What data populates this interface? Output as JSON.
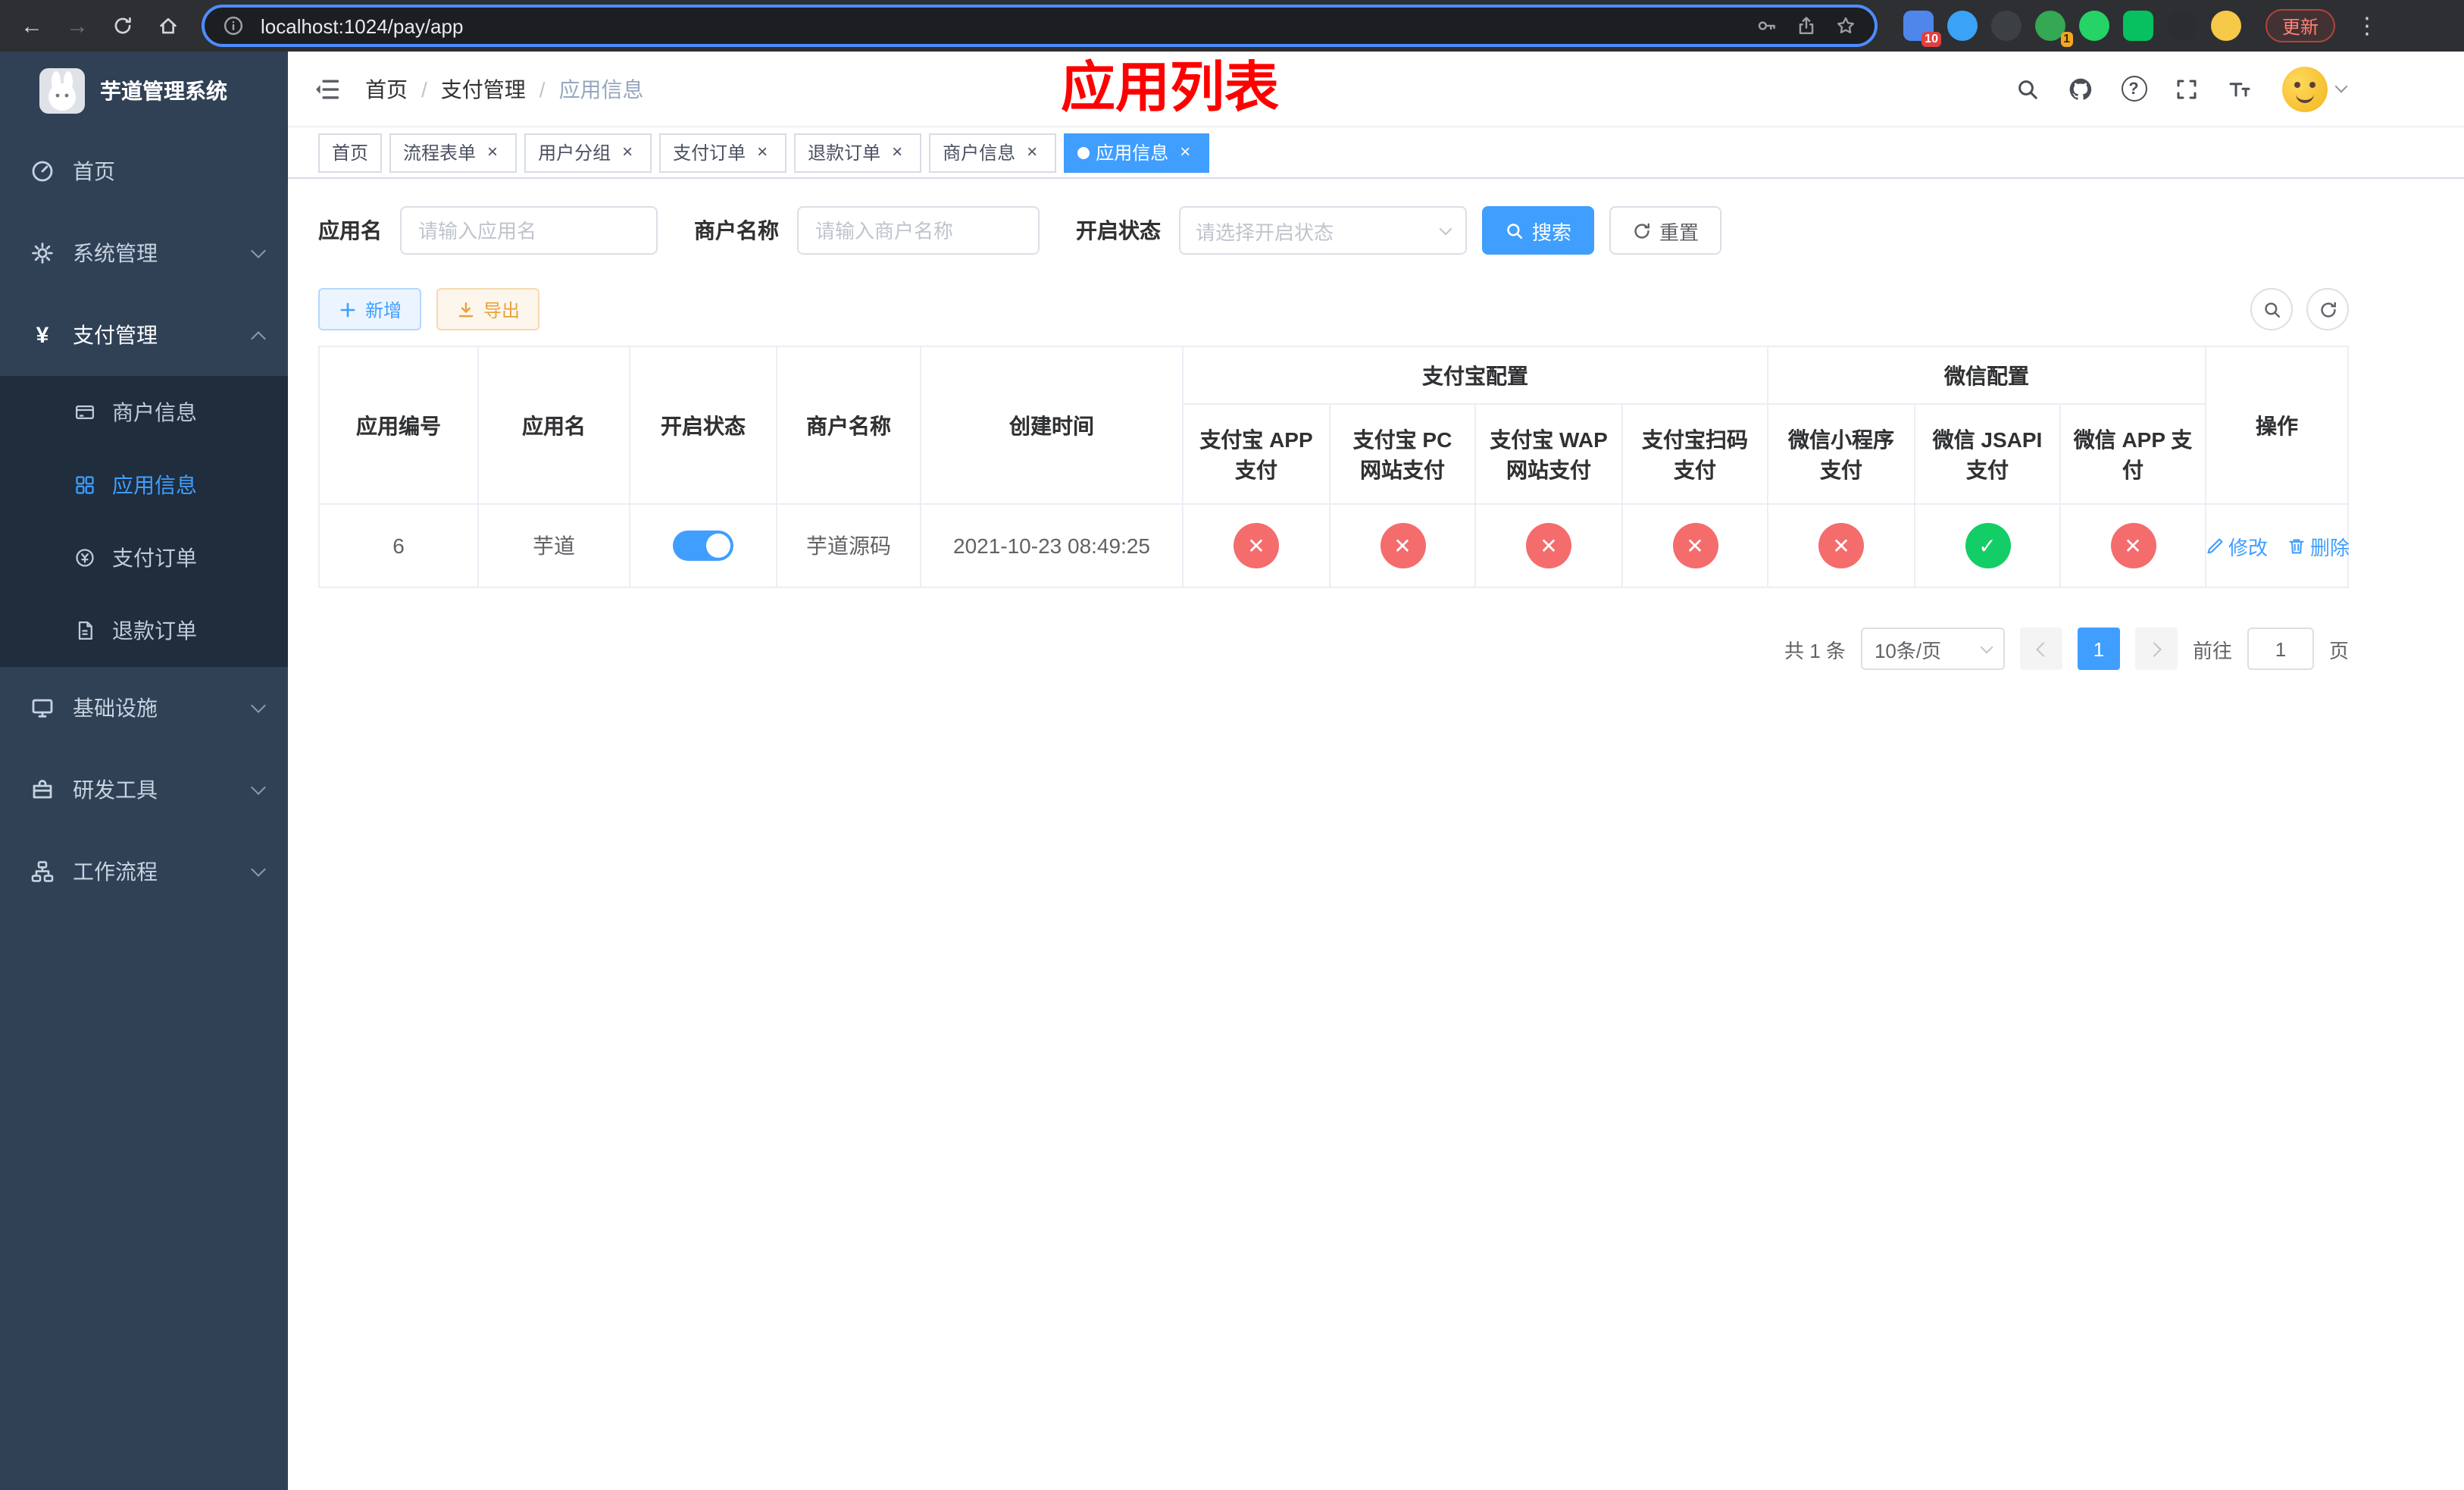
{
  "colors": {
    "accent": "#409eff",
    "danger": "#f56c6c",
    "success": "#13ce66",
    "warning": "#e6a23c",
    "title_red": "#ff0000",
    "sidebar_bg": "#304156",
    "submenu_bg": "#1f2d3d"
  },
  "icons": {
    "check": "✓",
    "cross": "✕",
    "close": "×",
    "kebab": "⋮",
    "back": "←",
    "forward": "→",
    "yen": "¥",
    "question": "?"
  },
  "browser": {
    "url": "localhost:1024/pay/app",
    "update_button": "更新",
    "extension_badge_a": "10",
    "extension_badge_b": "1"
  },
  "sidebar": {
    "app_title": "芋道管理系统",
    "items": [
      {
        "label": "首页"
      },
      {
        "label": "系统管理"
      },
      {
        "label": "支付管理",
        "children": [
          {
            "label": "商户信息"
          },
          {
            "label": "应用信息"
          },
          {
            "label": "支付订单"
          },
          {
            "label": "退款订单"
          }
        ]
      },
      {
        "label": "基础设施"
      },
      {
        "label": "研发工具"
      },
      {
        "label": "工作流程"
      }
    ]
  },
  "header": {
    "breadcrumb": [
      "首页",
      "支付管理",
      "应用信息"
    ],
    "breadcrumb_separator": "/",
    "page_title": "应用列表"
  },
  "tabs": [
    {
      "label": "首页"
    },
    {
      "label": "流程表单"
    },
    {
      "label": "用户分组"
    },
    {
      "label": "支付订单"
    },
    {
      "label": "退款订单"
    },
    {
      "label": "商户信息"
    },
    {
      "label": "应用信息"
    }
  ],
  "filters": {
    "app_name_label": "应用名",
    "app_name_placeholder": "请输入应用名",
    "merchant_label": "商户名称",
    "merchant_placeholder": "请输入商户名称",
    "status_label": "开启状态",
    "status_placeholder": "请选择开启状态",
    "search_button": "搜索",
    "reset_button": "重置"
  },
  "toolbar": {
    "add_button": "新增",
    "export_button": "导出"
  },
  "table": {
    "columns": {
      "app_id": "应用编号",
      "app_name": "应用名",
      "status": "开启状态",
      "merchant_name": "商户名称",
      "create_time": "创建时间",
      "alipay_group": "支付宝配置",
      "wechat_group": "微信配置",
      "alipay_cols": [
        "支付宝 APP 支付",
        "支付宝 PC 网站支付",
        "支付宝 WAP 网站支付",
        "支付宝扫码支付"
      ],
      "wechat_cols": [
        "微信小程序支付",
        "微信 JSAPI 支付",
        "微信 APP 支付"
      ],
      "actions": "操作"
    },
    "rows": [
      {
        "app_id": "6",
        "app_name": "芋道",
        "status": "on",
        "merchant_name": "芋道源码",
        "create_time": "2021-10-23 08:49:25",
        "configs": [
          "disabled",
          "disabled",
          "disabled",
          "disabled",
          "disabled",
          "enabled",
          "disabled"
        ],
        "edit_label": "修改",
        "delete_label": "删除"
      }
    ]
  },
  "pagination": {
    "total_text": "共 1 条",
    "page_size": "10条/页",
    "current_page": "1",
    "goto_prefix": "前往",
    "goto_value": "1",
    "goto_suffix": "页"
  }
}
